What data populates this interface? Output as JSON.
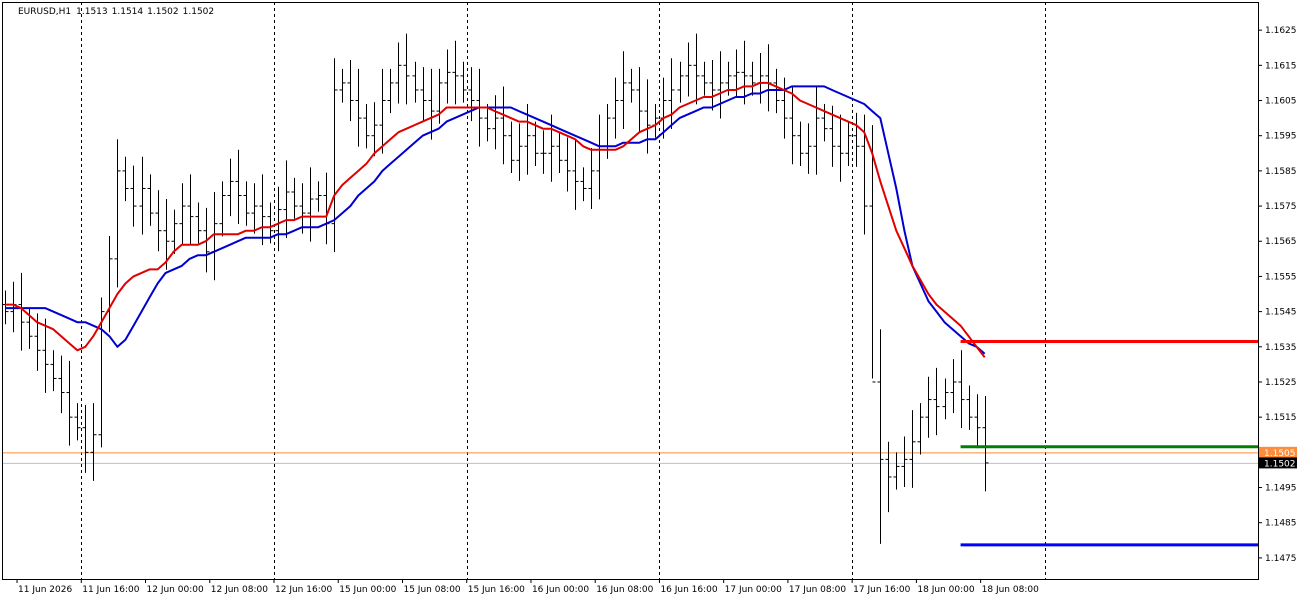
{
  "chart_title": {
    "symbol": "EURUSD,H1",
    "open": "1.1513",
    "high": "1.1514",
    "low": "1.1502",
    "close": "1.1502"
  },
  "price_labels": {
    "ask": "1.1505",
    "bid": "1.1502"
  },
  "colors": {
    "background": "#ffffff",
    "bars": "#000000",
    "ma_fast": "#e00000",
    "ma_slow": "#0000d0",
    "level_red": "#ff0000",
    "level_green": "#008000",
    "level_blue": "#0000ff",
    "ask_line": "#ff8c3a",
    "bid_line": "#c0c0c0",
    "grid": "#000000",
    "ask_label_bg": "#ff8c3a",
    "bid_label_bg": "#000000"
  },
  "chart_data": {
    "type": "ohlc",
    "grid": "vertical dashed separators",
    "ylim": [
      1.1469,
      1.1633
    ],
    "y_ticks": [
      "1.1625",
      "1.1615",
      "1.1605",
      "1.1595",
      "1.1585",
      "1.1575",
      "1.1565",
      "1.1555",
      "1.1545",
      "1.1535",
      "1.1525",
      "1.1515",
      "1.1505",
      "1.1495",
      "1.1485",
      "1.1475"
    ],
    "x_ticks": [
      "11 Jun 2026",
      "11 Jun 16:00",
      "12 Jun 00:00",
      "12 Jun 08:00",
      "12 Jun 16:00",
      "15 Jun 00:00",
      "15 Jun 08:00",
      "15 Jun 16:00",
      "16 Jun 00:00",
      "16 Jun 08:00",
      "16 Jun 16:00",
      "17 Jun 00:00",
      "17 Jun 08:00",
      "17 Jun 16:00",
      "18 Jun 00:00",
      "18 Jun 08:00"
    ],
    "hlines": [
      {
        "price": 1.15365,
        "color": "#ff0000",
        "start_tick": "18 Jun 00:00"
      },
      {
        "price": 1.15066,
        "color": "#008000",
        "start_tick": "18 Jun 00:00"
      },
      {
        "price": 1.14787,
        "color": "#0000ff",
        "start_tick": "18 Jun 00:00"
      }
    ],
    "closes": [
      1.1545,
      1.1547,
      1.1542,
      1.1538,
      1.1534,
      1.153,
      1.1526,
      1.1522,
      1.1515,
      1.1512,
      1.1505,
      1.151,
      1.1545,
      1.156,
      1.1585,
      1.158,
      1.1575,
      1.158,
      1.1573,
      1.1568,
      1.1565,
      1.157,
      1.1575,
      1.1572,
      1.1568,
      1.1562,
      1.157,
      1.1578,
      1.1582,
      1.1578,
      1.1573,
      1.1575,
      1.1572,
      1.1568,
      1.1574,
      1.1579,
      1.1575,
      1.1573,
      1.1577,
      1.1578,
      1.157,
      1.1608,
      1.161,
      1.1605,
      1.16,
      1.1595,
      1.1598,
      1.1605,
      1.161,
      1.1615,
      1.1612,
      1.1608,
      1.1605,
      1.1602,
      1.161,
      1.1613,
      1.1612,
      1.1608,
      1.1605,
      1.16,
      1.1597,
      1.16,
      1.1595,
      1.1588,
      1.1592,
      1.1595,
      1.159,
      1.159,
      1.1592,
      1.1588,
      1.1585,
      1.1582,
      1.158,
      1.1585,
      1.1592,
      1.16,
      1.1605,
      1.161,
      1.1608,
      1.1602,
      1.1598,
      1.16,
      1.1605,
      1.1608,
      1.1612,
      1.1615,
      1.1612,
      1.161,
      1.1608,
      1.161,
      1.1612,
      1.1613,
      1.1612,
      1.161,
      1.1612,
      1.161,
      1.1605,
      1.16,
      1.1595,
      1.159,
      1.1592,
      1.16,
      1.1597,
      1.1592,
      1.159,
      1.1595,
      1.1592,
      1.1575,
      1.1525,
      1.1503,
      1.1498,
      1.1501,
      1.1503,
      1.1508,
      1.1515,
      1.152,
      1.1518,
      1.1522,
      1.1525,
      1.152,
      1.1515,
      1.1512,
      1.1502
    ],
    "ma_fast": [
      1.1547,
      1.1547,
      1.1546,
      1.1544,
      1.1542,
      1.1541,
      1.154,
      1.1538,
      1.1536,
      1.1534,
      1.1535,
      1.1538,
      1.1542,
      1.1546,
      1.155,
      1.1553,
      1.1555,
      1.1556,
      1.1557,
      1.1557,
      1.1559,
      1.1562,
      1.1564,
      1.1564,
      1.1564,
      1.1565,
      1.1567,
      1.1567,
      1.1567,
      1.1567,
      1.1568,
      1.1568,
      1.1569,
      1.1569,
      1.157,
      1.1571,
      1.1571,
      1.1572,
      1.1572,
      1.1572,
      1.1572,
      1.1578,
      1.1581,
      1.1583,
      1.1585,
      1.1587,
      1.159,
      1.1592,
      1.1594,
      1.1596,
      1.1597,
      1.1598,
      1.1599,
      1.16,
      1.1601,
      1.1603,
      1.1603,
      1.1603,
      1.1603,
      1.1603,
      1.1603,
      1.1602,
      1.1601,
      1.16,
      1.1599,
      1.1599,
      1.1598,
      1.1597,
      1.1597,
      1.1596,
      1.1595,
      1.1594,
      1.1592,
      1.1591,
      1.1591,
      1.1591,
      1.1591,
      1.1592,
      1.1594,
      1.1596,
      1.1597,
      1.1598,
      1.16,
      1.1601,
      1.1603,
      1.1604,
      1.1605,
      1.1606,
      1.1606,
      1.1607,
      1.1608,
      1.1608,
      1.1609,
      1.1609,
      1.161,
      1.161,
      1.1609,
      1.1608,
      1.1607,
      1.1605,
      1.1604,
      1.1603,
      1.1602,
      1.1601,
      1.16,
      1.1599,
      1.1598,
      1.1596,
      1.159,
      1.1582,
      1.1575,
      1.1568,
      1.1563,
      1.1558,
      1.1554,
      1.155,
      1.1547,
      1.1545,
      1.1543,
      1.1541,
      1.1538,
      1.1535,
      1.1532
    ],
    "ma_slow": [
      1.1546,
      1.1546,
      1.1546,
      1.1546,
      1.1546,
      1.1546,
      1.1545,
      1.1544,
      1.1543,
      1.1542,
      1.1542,
      1.1541,
      1.154,
      1.1538,
      1.1535,
      1.1537,
      1.1541,
      1.1545,
      1.1549,
      1.1553,
      1.1556,
      1.1557,
      1.1558,
      1.156,
      1.1561,
      1.1561,
      1.1562,
      1.1563,
      1.1564,
      1.1565,
      1.1566,
      1.1566,
      1.1566,
      1.1566,
      1.1567,
      1.1567,
      1.1568,
      1.1569,
      1.1569,
      1.1569,
      1.157,
      1.1571,
      1.1573,
      1.1575,
      1.1578,
      1.158,
      1.1582,
      1.1585,
      1.1587,
      1.1589,
      1.1591,
      1.1593,
      1.1595,
      1.1596,
      1.1597,
      1.1599,
      1.16,
      1.1601,
      1.1602,
      1.1603,
      1.1603,
      1.1603,
      1.1603,
      1.1603,
      1.1602,
      1.1601,
      1.16,
      1.1599,
      1.1598,
      1.1597,
      1.1596,
      1.1595,
      1.1594,
      1.1593,
      1.1592,
      1.1592,
      1.1592,
      1.1593,
      1.1593,
      1.1593,
      1.1594,
      1.1594,
      1.1596,
      1.1598,
      1.16,
      1.1601,
      1.1602,
      1.1603,
      1.1603,
      1.1604,
      1.1605,
      1.1606,
      1.1606,
      1.1607,
      1.1607,
      1.1608,
      1.1608,
      1.1608,
      1.1609,
      1.1609,
      1.1609,
      1.1609,
      1.1609,
      1.1608,
      1.1607,
      1.1606,
      1.1605,
      1.1604,
      1.1602,
      1.16,
      1.159,
      1.158,
      1.1568,
      1.1558,
      1.1553,
      1.1548,
      1.1545,
      1.1542,
      1.154,
      1.1538,
      1.1536,
      1.1535,
      1.1533
    ]
  }
}
